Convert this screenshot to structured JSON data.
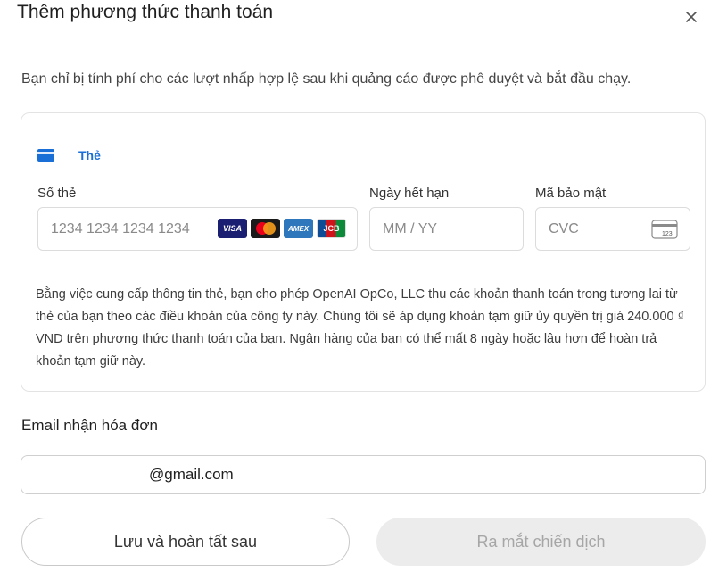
{
  "dialog": {
    "title": "Thêm phương thức thanh toán",
    "notice": "Bạn chỉ bị tính phí cho các lượt nhấp hợp lệ sau khi quảng cáo được phê duyệt và bắt đầu chạy."
  },
  "card": {
    "tab_label": "Thẻ",
    "number_label": "Số thẻ",
    "number_placeholder": "1234 1234 1234 1234",
    "expiry_label": "Ngày hết hạn",
    "expiry_placeholder": "MM / YY",
    "cvc_label": "Mã bảo mật",
    "cvc_placeholder": "CVC",
    "cvc_icon_text": "123",
    "brands": {
      "visa": "VISA",
      "amex": "AMEX",
      "jcb": "JCB"
    },
    "disclaimer": "Bằng việc cung cấp thông tin thẻ, bạn cho phép OpenAI OpCo, LLC thu các khoản thanh toán trong tương lai từ thẻ của bạn theo các điều khoản của công ty này. Chúng tôi sẽ áp dụng khoản tạm giữ ủy quyền trị giá 240.000 ₫ VND trên phương thức thanh toán của bạn. Ngân hàng của bạn có thể mất 8 ngày hoặc lâu hơn để hoàn trả khoản tạm giữ này."
  },
  "email": {
    "label": "Email nhận hóa đơn",
    "value": "@gmail.com"
  },
  "buttons": {
    "save_later": "Lưu và hoàn tất sau",
    "launch": "Ra mắt chiến dịch"
  },
  "colors": {
    "accent": "#1a6fd6",
    "visa": "#1a1f71",
    "mastercard_red": "#eb001b",
    "mastercard_yellow": "#f79e1b",
    "amex": "#2e77bc",
    "disabled_bg": "#ececec"
  }
}
